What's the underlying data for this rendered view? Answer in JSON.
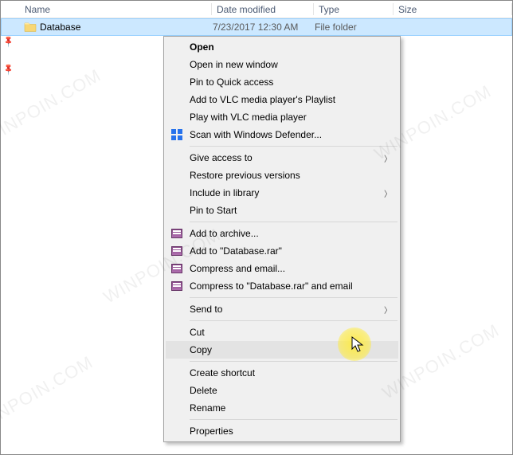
{
  "columns": {
    "name": "Name",
    "date": "Date modified",
    "type": "Type",
    "size": "Size"
  },
  "file": {
    "name": "Database",
    "date": "7/23/2017 12:30 AM",
    "type": "File folder"
  },
  "menu": {
    "open": "Open",
    "open_new_window": "Open in new window",
    "pin_quick": "Pin to Quick access",
    "add_vlc_playlist": "Add to VLC media player's Playlist",
    "play_vlc": "Play with VLC media player",
    "scan_defender": "Scan with Windows Defender...",
    "give_access": "Give access to",
    "restore_versions": "Restore previous versions",
    "include_library": "Include in library",
    "pin_start": "Pin to Start",
    "add_archive": "Add to archive...",
    "add_rar": "Add to \"Database.rar\"",
    "compress_email": "Compress and email...",
    "compress_rar_email": "Compress to \"Database.rar\" and email",
    "send_to": "Send to",
    "cut": "Cut",
    "copy": "Copy",
    "create_shortcut": "Create shortcut",
    "delete": "Delete",
    "rename": "Rename",
    "properties": "Properties"
  },
  "watermark": "WINPOIN.COM"
}
